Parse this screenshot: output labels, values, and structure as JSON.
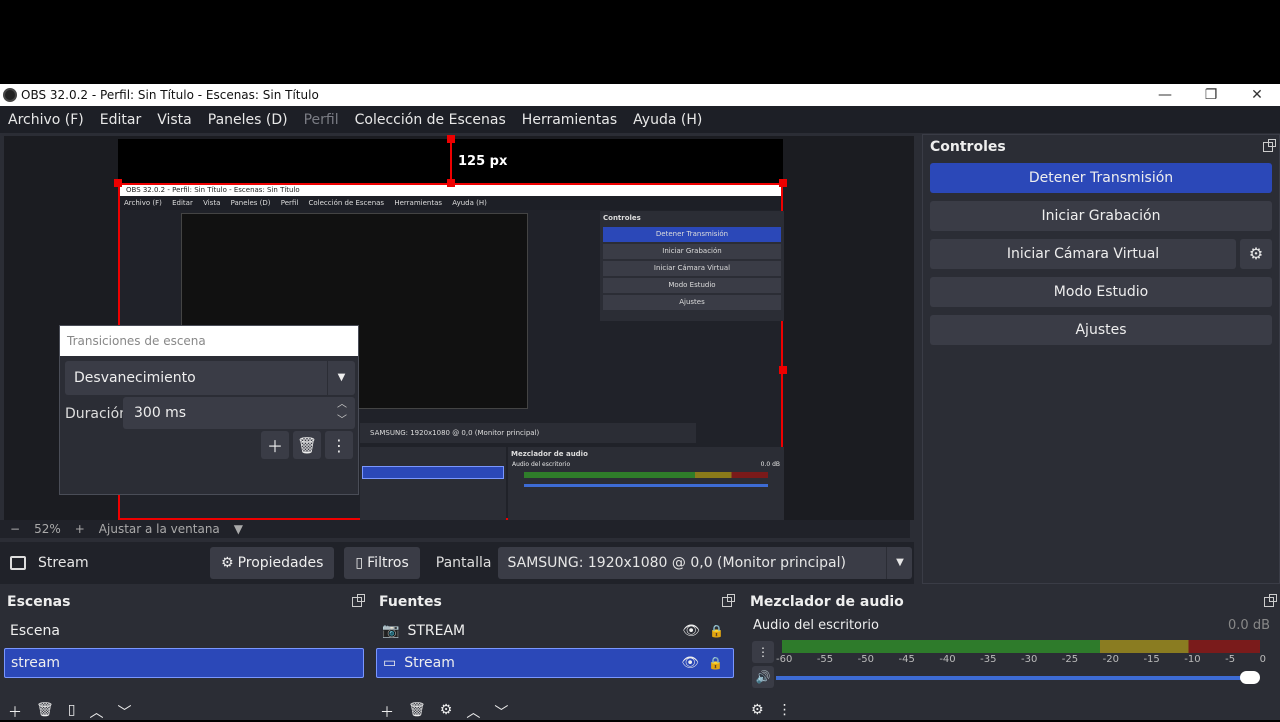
{
  "window": {
    "title": "OBS 32.0.2 - Perfil: Sin Título - Escenas: Sin Título",
    "minimize": "—",
    "maximize": "❐",
    "close": "✕"
  },
  "menu": [
    "Archivo (F)",
    "Editar",
    "Vista",
    "Paneles (D)",
    "Perfil",
    "Colección de Escenas",
    "Herramientas",
    "Ayuda (H)"
  ],
  "preview": {
    "px_label": "125 px",
    "nested_title": "OBS 32.0.2 - Perfil: Sin Título - Escenas: Sin Título",
    "nested_menu": [
      "Archivo (F)",
      "Editar",
      "Vista",
      "Paneles (D)",
      "Perfil",
      "Colección de Escenas",
      "Herramientas",
      "Ayuda (H)"
    ],
    "nested_controls_title": "Controles",
    "nested_controls": [
      "Detener Transmisión",
      "Iniciar Grabación",
      "Iniciar Cámara Virtual",
      "Modo Estudio",
      "Ajustes"
    ],
    "nested_screen": "SAMSUNG: 1920x1080 @ 0,0 (Monitor principal)",
    "nested_audio_title": "Mezclador de audio",
    "nested_audio_channel": "Audio del escritorio",
    "nested_audio_db": "0.0 dB"
  },
  "transitions": {
    "title": "Transiciones de escena",
    "selected": "Desvanecimiento",
    "duration_label": "Duración",
    "duration_value": "300 ms"
  },
  "zoom": {
    "minus": "−",
    "percent": "52%",
    "plus": "+",
    "fit": "Ajustar a la ventana"
  },
  "source_bar": {
    "name": "Stream",
    "properties": "Propiedades",
    "filters": "Filtros",
    "display_label": "Pantalla",
    "display_value": "SAMSUNG: 1920x1080 @ 0,0 (Monitor principal)"
  },
  "controls": {
    "title": "Controles",
    "stop_stream": "Detener Transmisión",
    "start_recording": "Iniciar Grabación",
    "start_virtual_cam": "Iniciar Cámara Virtual",
    "studio_mode": "Modo Estudio",
    "settings": "Ajustes"
  },
  "scenes": {
    "title": "Escenas",
    "items": [
      "Escena",
      "stream"
    ]
  },
  "sources": {
    "title": "Fuentes",
    "items": [
      "STREAM",
      "Stream"
    ]
  },
  "mixer": {
    "title": "Mezclador de audio",
    "channel": "Audio del escritorio",
    "db": "0.0 dB",
    "scale": [
      "-60",
      "-55",
      "-50",
      "-45",
      "-40",
      "-35",
      "-30",
      "-25",
      "-20",
      "-15",
      "-10",
      "-5",
      "0"
    ],
    "volume": 1.0
  },
  "colors": {
    "accent": "#2b48b8",
    "selection_border": "#e00000",
    "background": "#2b2d35"
  }
}
